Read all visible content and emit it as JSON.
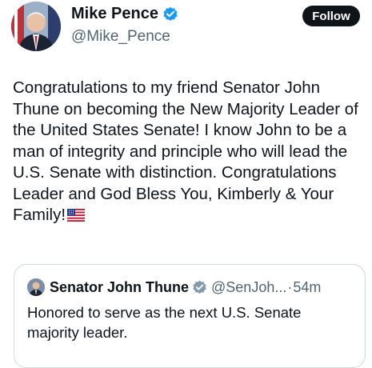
{
  "author": {
    "display_name": "Mike Pence",
    "handle": "@Mike_Pence",
    "avatar_icon": "profile-photo",
    "verified_icon": "verified-badge-icon",
    "verified_color": "#1d9bf0"
  },
  "follow_button": {
    "label": "Follow",
    "bg_color": "#0f1419",
    "text_color": "#ffffff"
  },
  "tweet": {
    "text": "Congratulations to my friend Senator John Thune on becoming the New Majority Leader of the United States Senate! I know John to be a man of integrity and principle who will lead the U.S. Senate with distinction. Congratulations Leader and God Bless You, Kimberly & Your Family!",
    "emoji": "us-flag-emoji"
  },
  "quoted_tweet": {
    "display_name": "Senator John Thune",
    "handle": "@SenJoh...",
    "separator": "·",
    "time": "54m",
    "verified_icon": "verified-badge-gray-icon",
    "text": "Honored to serve as the next U.S. Senate majority leader."
  }
}
